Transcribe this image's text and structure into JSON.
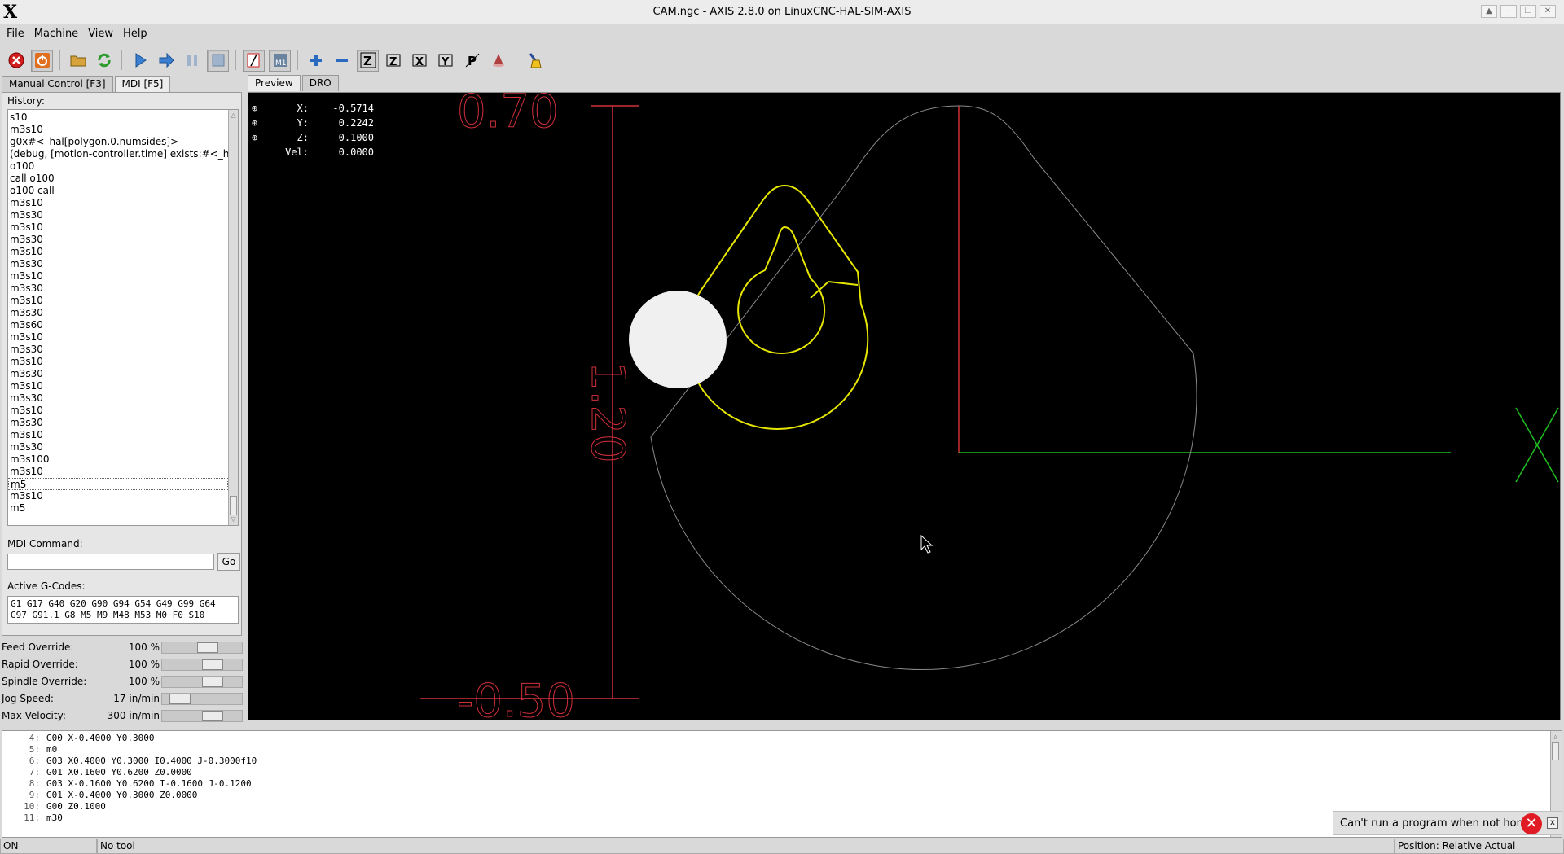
{
  "window": {
    "title": "CAM.ngc - AXIS 2.8.0 on LinuxCNC-HAL-SIM-AXIS",
    "logo": "X"
  },
  "menu": [
    "File",
    "Machine",
    "View",
    "Help"
  ],
  "toolbar_icons": [
    "estop-icon",
    "power-icon",
    "open-file-icon",
    "reload-icon",
    "run-icon",
    "step-icon",
    "pause-icon",
    "stop-icon",
    "block-delete-icon",
    "optional-stop-icon",
    "zoom-in-icon",
    "zoom-out-icon",
    "view-z-icon",
    "view-z2-icon",
    "view-x-icon",
    "view-y-icon",
    "view-p-icon",
    "rotate-view-icon",
    "clear-plot-icon"
  ],
  "left_tabs": [
    "Manual Control [F3]",
    "MDI [F5]"
  ],
  "history": {
    "label": "History:",
    "items": [
      "s10",
      "m3s10",
      "g0x#<_hal[polygon.0.numsides]>",
      "(debug, [motion-controller.time] exists:#<_h",
      "o100",
      "call o100",
      "o100 call",
      "m3s10",
      "m3s30",
      "m3s10",
      "m3s30",
      "m3s10",
      "m3s30",
      "m3s10",
      "m3s30",
      "m3s10",
      "m3s30",
      "m3s60",
      "m3s10",
      "m3s30",
      "m3s10",
      "m3s30",
      "m3s10",
      "m3s30",
      "m3s10",
      "m3s30",
      "m3s10",
      "m3s30",
      "m3s100",
      "m3s10",
      "m5",
      "m3s10",
      "m5"
    ],
    "selected_index": 30
  },
  "mdi": {
    "label": "MDI Command:",
    "value": "",
    "go": "Go"
  },
  "gcodes": {
    "label": "Active G-Codes:",
    "line1": "G1 G17 G40 G20 G90 G94 G54 G49 G99 G64",
    "line2": "G97 G91.1 G8 M5 M9 M48 M53 M0 F0 S10"
  },
  "overrides": [
    {
      "name": "Feed Override:",
      "value": "100 %",
      "level": 0.6
    },
    {
      "name": "Rapid Override:",
      "value": "100 %",
      "level": 0.68
    },
    {
      "name": "Spindle Override:",
      "value": "100 %",
      "level": 0.68
    },
    {
      "name": "Jog Speed:",
      "value": "17 in/min",
      "level": 0.12
    },
    {
      "name": "Max Velocity:",
      "value": "300 in/min",
      "level": 0.68
    }
  ],
  "right_tabs": [
    "Preview",
    "DRO"
  ],
  "dro": [
    {
      "axis": "X:",
      "value": "-0.5714"
    },
    {
      "axis": "Y:",
      "value": "0.2242"
    },
    {
      "axis": "Z:",
      "value": "0.1000"
    },
    {
      "axis": "Vel:",
      "value": "0.0000"
    }
  ],
  "preview": {
    "dim_top": "0.70",
    "dim_mid": "1.20",
    "dim_bottom": "-0.50",
    "colors": {
      "dimension": "#d0303a",
      "toolpath": "#e6e600",
      "feed_line": "#bdbdbd",
      "x_axis": "#20c020",
      "y_axis": "#d03030"
    }
  },
  "code_lines": [
    {
      "n": "4:",
      "t": "G00 X-0.4000 Y0.3000"
    },
    {
      "n": "5:",
      "t": "m0"
    },
    {
      "n": "6:",
      "t": "G03 X0.4000 Y0.3000 I0.4000 J-0.3000f10"
    },
    {
      "n": "7:",
      "t": "G01 X0.1600 Y0.6200 Z0.0000"
    },
    {
      "n": "8:",
      "t": "G03 X-0.1600 Y0.6200 I-0.1600 J-0.1200"
    },
    {
      "n": "9:",
      "t": "G01 X-0.4000 Y0.3000 Z0.0000"
    },
    {
      "n": "10:",
      "t": "G00 Z0.1000"
    },
    {
      "n": "11:",
      "t": "m30"
    }
  ],
  "notification": {
    "text": "Can't run a program when not homed",
    "close": "x"
  },
  "status": {
    "state": "ON",
    "tool": "No tool",
    "position": "Position: Relative Actual"
  }
}
